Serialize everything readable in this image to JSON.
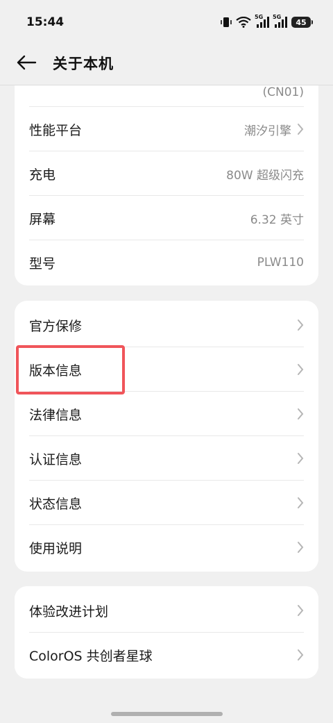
{
  "status_bar": {
    "time": "15:44",
    "network_labels": [
      "5G",
      "5G"
    ],
    "battery": "45"
  },
  "header": {
    "title": "关于本机"
  },
  "card1": {
    "cut_off_value": "(CN01)",
    "rows": [
      {
        "label": "性能平台",
        "value": "潮汐引擎",
        "chevron": true
      },
      {
        "label": "充电",
        "value": "80W 超级闪充",
        "chevron": false
      },
      {
        "label": "屏幕",
        "value": "6.32 英寸",
        "chevron": false
      },
      {
        "label": "型号",
        "value": "PLW110",
        "chevron": false
      }
    ]
  },
  "card2": {
    "rows": [
      {
        "label": "官方保修"
      },
      {
        "label": "版本信息",
        "highlighted": true
      },
      {
        "label": "法律信息"
      },
      {
        "label": "认证信息"
      },
      {
        "label": "状态信息"
      },
      {
        "label": "使用说明"
      }
    ]
  },
  "card3": {
    "rows": [
      {
        "label": "体验改进计划"
      },
      {
        "label": "ColorOS 共创者星球"
      }
    ]
  },
  "colors": {
    "background": "#f0f0f0",
    "card": "#ffffff",
    "highlight": "#f0555a",
    "secondary_text": "#8a8a8a"
  }
}
